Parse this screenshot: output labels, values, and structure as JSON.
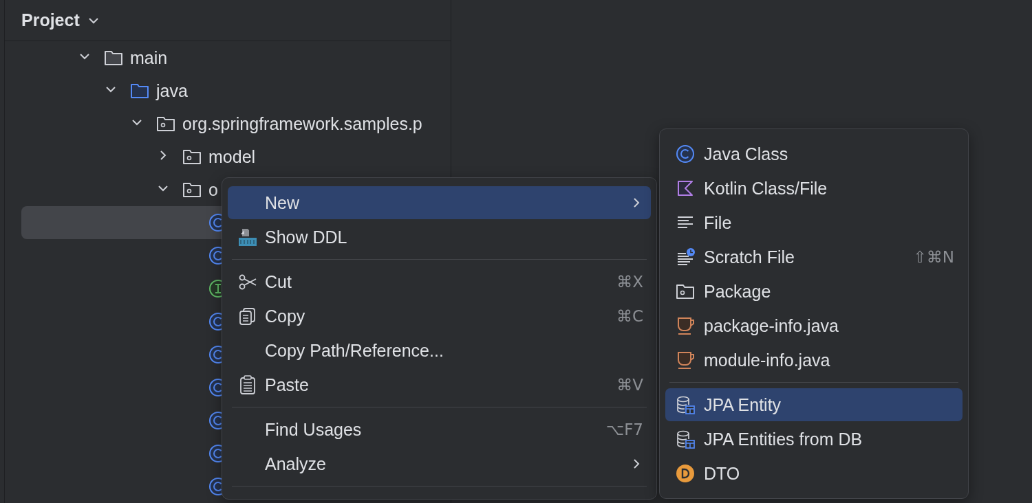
{
  "panel": {
    "title": "Project"
  },
  "tree": [
    {
      "label": "main",
      "kind": "folder",
      "expanded": true,
      "selected": false,
      "children": [
        {
          "label": "java",
          "kind": "source-folder",
          "expanded": true,
          "selected": false,
          "children": [
            {
              "label": "org.springframework.samples.p",
              "kind": "package",
              "expanded": true,
              "selected": false,
              "children": [
                {
                  "label": "model",
                  "kind": "package",
                  "expanded": false,
                  "selected": false
                },
                {
                  "label": "o",
                  "kind": "package",
                  "expanded": true,
                  "selected": false,
                  "children": [
                    {
                      "kind": "class",
                      "selected": true
                    },
                    {
                      "kind": "class",
                      "selected": false
                    },
                    {
                      "kind": "interface",
                      "selected": false
                    },
                    {
                      "kind": "class",
                      "selected": false
                    },
                    {
                      "kind": "class",
                      "selected": false
                    },
                    {
                      "kind": "class",
                      "selected": false
                    },
                    {
                      "kind": "class",
                      "selected": false
                    },
                    {
                      "kind": "class",
                      "selected": false
                    },
                    {
                      "kind": "class",
                      "selected": false
                    }
                  ]
                }
              ]
            }
          ]
        }
      ]
    }
  ],
  "context_menu": [
    {
      "kind": "plain",
      "label": "New",
      "submenu": true,
      "selected": true
    },
    {
      "kind": "ddl",
      "label": "Show DDL",
      "selected": false
    },
    {
      "kind": "separator"
    },
    {
      "kind": "scissors",
      "label": "Cut",
      "shortcut": "⌘X",
      "selected": false
    },
    {
      "kind": "copy",
      "label": "Copy",
      "shortcut": "⌘C",
      "selected": false
    },
    {
      "kind": "plain",
      "label": "Copy Path/Reference...",
      "selected": false
    },
    {
      "kind": "paste",
      "label": "Paste",
      "shortcut": "⌘V",
      "selected": false
    },
    {
      "kind": "separator"
    },
    {
      "kind": "plain",
      "label": "Find Usages",
      "shortcut": "⌥F7",
      "selected": false
    },
    {
      "kind": "plain",
      "label": "Analyze",
      "submenu": true,
      "selected": false
    },
    {
      "kind": "separator"
    }
  ],
  "submenu": [
    {
      "kind": "java-class",
      "label": "Java Class",
      "selected": false
    },
    {
      "kind": "kotlin",
      "label": "Kotlin Class/File",
      "selected": false
    },
    {
      "kind": "file",
      "label": "File",
      "selected": false
    },
    {
      "kind": "scratch",
      "label": "Scratch File",
      "shortcut": "⇧⌘N",
      "selected": false
    },
    {
      "kind": "package",
      "label": "Package",
      "selected": false
    },
    {
      "kind": "java-file",
      "label": "package-info.java",
      "selected": false
    },
    {
      "kind": "java-file",
      "label": "module-info.java",
      "selected": false
    },
    {
      "kind": "separator"
    },
    {
      "kind": "jpa",
      "label": "JPA Entity",
      "selected": true
    },
    {
      "kind": "jpa",
      "label": "JPA Entities from DB",
      "selected": false
    },
    {
      "kind": "dto",
      "label": "DTO",
      "selected": false
    }
  ]
}
